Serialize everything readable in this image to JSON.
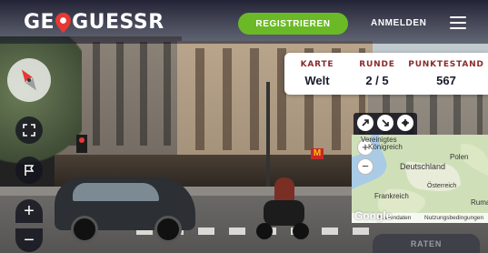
{
  "header": {
    "logo_parts": [
      "GE",
      "GUESSR"
    ],
    "register_label": "REGISTRIEREN",
    "login_label": "ANMELDEN",
    "menu_icon": "hamburger-menu-icon",
    "colors": {
      "register_bg": "#6cb928",
      "logo_pin": "#e53935"
    }
  },
  "status": {
    "map": {
      "label": "KARTE",
      "value": "Welt"
    },
    "round": {
      "label": "RUNDE",
      "value": "2 / 5"
    },
    "score": {
      "label": "PUNKTESTAND",
      "value": "567"
    },
    "label_color": "#8a2b2b"
  },
  "controls": {
    "compass_icon": "compass-icon",
    "fullscreen_icon": "fullscreen-icon",
    "flag_icon": "flag-icon",
    "zoom_in": "+",
    "zoom_out": "−"
  },
  "minimap": {
    "tool_icons": [
      "expand-map-icon",
      "shrink-map-icon",
      "pin-map-icon"
    ],
    "zoom_in": "+",
    "zoom_out": "−",
    "places": {
      "vereinigtes": "Vereinigtes",
      "koenigreich": "Königreich",
      "polen": "Polen",
      "deutschland": "Deutschland",
      "oesterreich": "Österreich",
      "frankreich": "Frankreich",
      "rumaenien": "Ruma"
    },
    "google": "Google",
    "footer_data": "Kartendaten",
    "footer_terms": "Nutzungsbedingungen"
  },
  "guess_button": "RATEN",
  "scene": {
    "sign_text": "M"
  }
}
